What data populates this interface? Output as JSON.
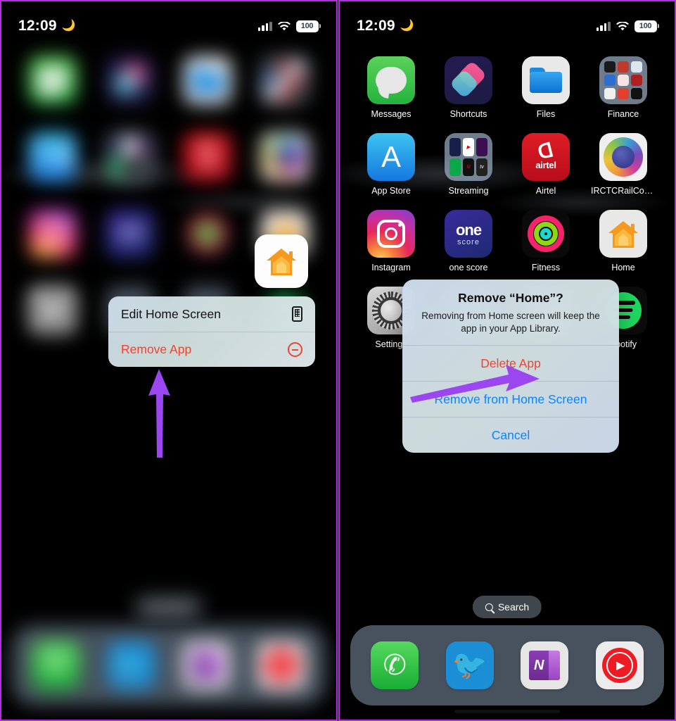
{
  "statusbar": {
    "time": "12:09",
    "moon_icon": "moon-icon",
    "signal_icon": "cellular-signal-icon",
    "wifi_icon": "wifi-icon",
    "battery_level": "100"
  },
  "left_panel": {
    "highlighted_app": {
      "label": "Home",
      "icon": "home-app-icon"
    },
    "context_menu": {
      "items": [
        {
          "label": "Edit Home Screen",
          "icon": "home-screen-grid-icon",
          "style": "normal"
        },
        {
          "label": "Remove App",
          "icon": "minus-circle-icon",
          "style": "destructive"
        }
      ]
    },
    "annotation_arrow": {
      "color": "#9b46f0",
      "points_to": "Remove App",
      "direction": "up"
    }
  },
  "right_panel": {
    "apps": [
      {
        "label": "Messages",
        "icon": "messages-icon"
      },
      {
        "label": "Shortcuts",
        "icon": "shortcuts-icon"
      },
      {
        "label": "Files",
        "icon": "files-icon"
      },
      {
        "label": "Finance",
        "icon": "finance-folder-icon"
      },
      {
        "label": "App Store",
        "icon": "app-store-icon"
      },
      {
        "label": "Streaming",
        "icon": "streaming-folder-icon"
      },
      {
        "label": "Airtel",
        "icon": "airtel-icon"
      },
      {
        "label": "IRCTCRailConn…",
        "icon": "irctc-rail-connect-icon"
      },
      {
        "label": "Instagram",
        "icon": "instagram-icon"
      },
      {
        "label": "one score",
        "icon": "onescore-icon"
      },
      {
        "label": "Fitness",
        "icon": "fitness-rings-icon"
      },
      {
        "label": "Home",
        "icon": "home-app-icon"
      },
      {
        "label": "Settings",
        "icon": "settings-gear-icon"
      },
      {
        "label": "",
        "icon": "hidden-app-icon"
      },
      {
        "label": "",
        "icon": "hidden-app-icon"
      },
      {
        "label": "Spotify",
        "icon": "spotify-icon"
      }
    ],
    "onescore": {
      "line1": "one",
      "line2": "score"
    },
    "airtel": {
      "wordmark": "airtel"
    },
    "onenote": {
      "letter": "N"
    },
    "search": {
      "label": "Search",
      "icon": "search-icon"
    },
    "dock": [
      {
        "label": "Phone",
        "icon": "phone-icon"
      },
      {
        "label": "Twitter",
        "icon": "twitter-bird-icon"
      },
      {
        "label": "OneNote",
        "icon": "onenote-icon"
      },
      {
        "label": "YouTube Music",
        "icon": "youtube-music-icon"
      }
    ],
    "alert": {
      "title": "Remove “Home”?",
      "message": "Removing from Home screen will keep the app in your App Library.",
      "buttons": [
        {
          "label": "Delete App",
          "style": "destructive"
        },
        {
          "label": "Remove from Home Screen",
          "style": "normal"
        },
        {
          "label": "Cancel",
          "style": "normal"
        }
      ]
    },
    "annotation_arrow": {
      "color": "#9b46f0",
      "points_to": "Delete App",
      "direction": "right"
    }
  },
  "colors": {
    "destructive": "#f5402c",
    "link": "#0a84ff",
    "annotation": "#9b46f0",
    "panel_border": "#b829e8"
  }
}
